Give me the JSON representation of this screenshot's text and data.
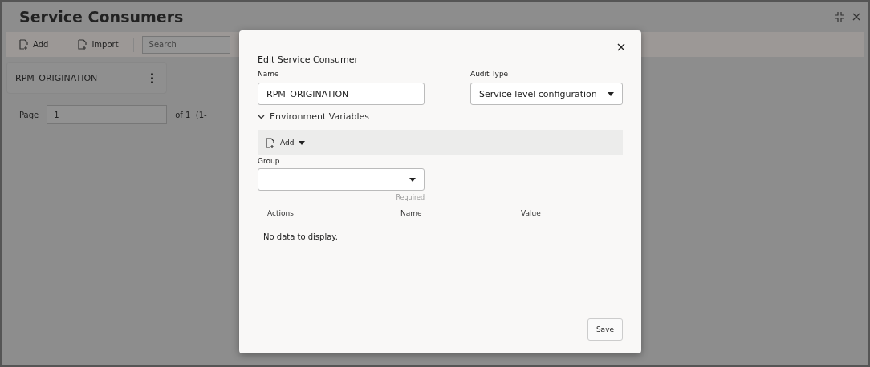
{
  "page": {
    "title": "Service Consumers",
    "toolbar": {
      "buttons": [
        "Add",
        "Import"
      ],
      "search": {
        "placeholder": "Search"
      }
    },
    "cards": [
      {
        "name": "RPM_ORIGINATION"
      }
    ],
    "pagination": {
      "label": "Page",
      "value": "1",
      "summary": "of 1  (1-"
    }
  },
  "dialog": {
    "title": "Edit Service Consumer",
    "fields": [
      {
        "kind": "text",
        "label": "Name",
        "value": "RPM_ORIGINATION"
      },
      {
        "kind": "select",
        "label": "Audit Type",
        "value": "Service level configuration"
      }
    ],
    "section": {
      "label": "Environment Variables",
      "expanded": true
    },
    "toolbar": {
      "add": "Add"
    },
    "group": {
      "label": "Group",
      "hint": "Required"
    },
    "table": {
      "columns": [
        "Actions",
        "Name",
        "Value"
      ],
      "empty": "No data to display."
    },
    "save": "Save"
  }
}
